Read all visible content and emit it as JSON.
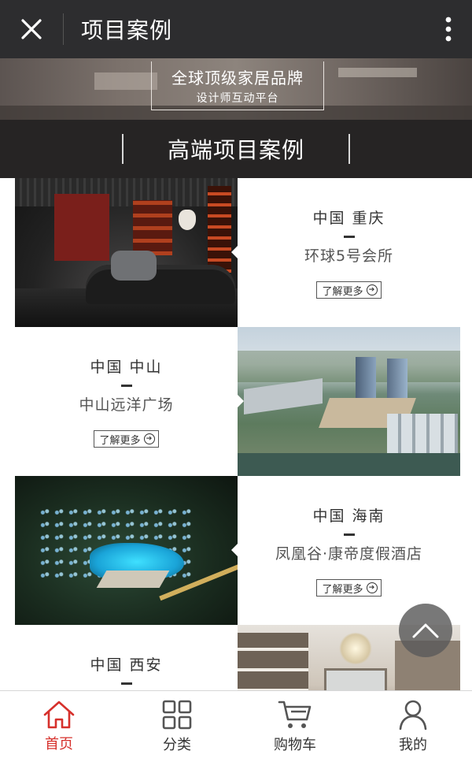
{
  "topbar": {
    "title": "项目案例",
    "close_icon": "close-icon",
    "more_icon": "more-vertical-icon"
  },
  "banner": {
    "line1": "全球顶级家居品牌",
    "line2": "设计师互动平台"
  },
  "section": {
    "title": "高端项目案例"
  },
  "projects": [
    {
      "location": "中国 重庆",
      "name": "环球5号会所",
      "more_label": "了解更多",
      "layout": "image-left"
    },
    {
      "location": "中国 中山",
      "name": "中山远洋广场",
      "more_label": "了解更多",
      "layout": "image-right"
    },
    {
      "location": "中国 海南",
      "name": "凤凰谷·康帝度假酒店",
      "more_label": "了解更多",
      "layout": "image-left"
    },
    {
      "location": "中国 西安",
      "name": "",
      "more_label": "",
      "layout": "image-right"
    }
  ],
  "back_to_top": {
    "icon": "chevron-up-icon"
  },
  "bottom_nav": [
    {
      "label": "首页",
      "icon": "home-icon",
      "active": true
    },
    {
      "label": "分类",
      "icon": "grid-icon",
      "active": false
    },
    {
      "label": "购物车",
      "icon": "cart-icon",
      "active": false
    },
    {
      "label": "我的",
      "icon": "user-icon",
      "active": false
    }
  ],
  "colors": {
    "accent": "#d6302b",
    "topbar": "#2d2d2f",
    "section_header": "#262424"
  }
}
